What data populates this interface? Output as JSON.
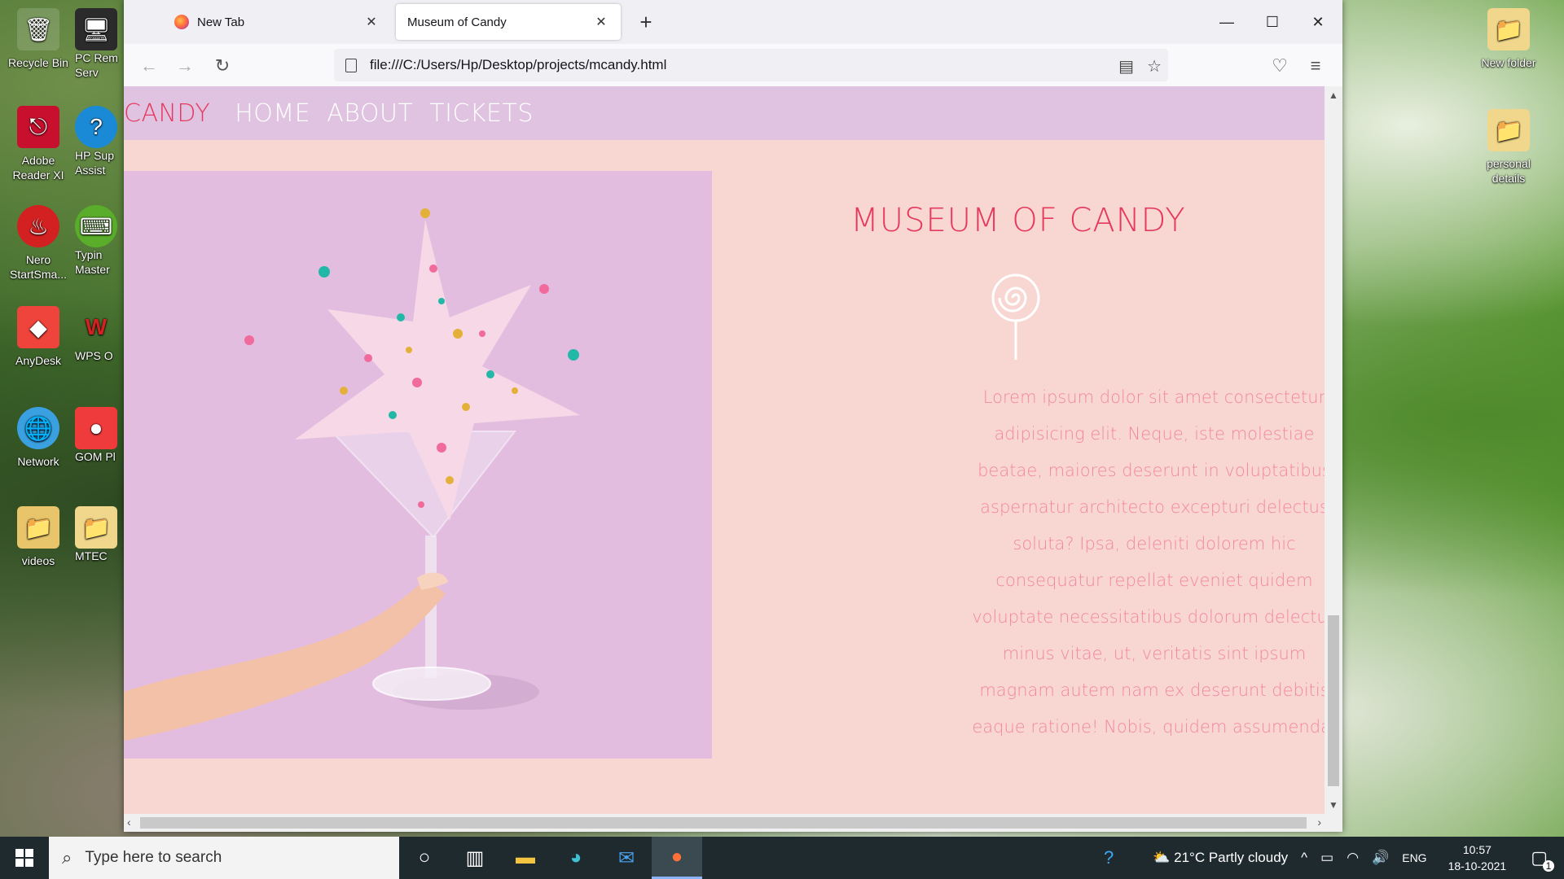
{
  "desktop": {
    "icons_left": [
      {
        "label": "Recycle Bin",
        "icon": "recycle-bin-icon"
      },
      {
        "label": "PC Rem Serv",
        "icon": "remote-icon"
      },
      {
        "label": "Adobe Reader XI",
        "icon": "pdf-icon"
      },
      {
        "label": "HP Sup Assist",
        "icon": "help-icon"
      },
      {
        "label": "Nero StartSma...",
        "icon": "nero-icon"
      },
      {
        "label": "Typin Master",
        "icon": "typing-icon"
      },
      {
        "label": "AnyDesk",
        "icon": "anydesk-icon"
      },
      {
        "label": "WPS O",
        "icon": "wps-icon"
      },
      {
        "label": "Network",
        "icon": "network-icon"
      },
      {
        "label": "GOM Pl",
        "icon": "gom-icon"
      },
      {
        "label": "videos",
        "icon": "folder-icon"
      },
      {
        "label": "MTEC",
        "icon": "folder-icon"
      }
    ],
    "icons_right": [
      {
        "label": "New folder",
        "icon": "folder-icon"
      },
      {
        "label": "personal details",
        "icon": "folder-icon"
      }
    ]
  },
  "browser": {
    "tabs": [
      {
        "title": "New Tab"
      },
      {
        "title": "Museum of Candy"
      }
    ],
    "url": "file:///C:/Users/Hp/Desktop/projects/mcandy.html"
  },
  "site": {
    "brand": "CANDY",
    "nav": [
      "HOME",
      "ABOUT",
      "TICKETS"
    ],
    "title": "MUSEUM OF CANDY",
    "body": "Lorem ipsum dolor sit amet consectetur adipisicing elit. Neque, iste molestiae beatae, maiores deserunt in voluptatibus aspernatur architecto excepturi delectus soluta? Ipsa, deleniti dolorem hic consequatur repellat eveniet quidem voluptate necessitatibus dolorum delectus minus vitae, ut, veritatis sint ipsum magnam autem nam ex deserunt debitis eaque ratione! Nobis, quidem assumenda."
  },
  "taskbar": {
    "search_placeholder": "Type here to search",
    "weather": "21°C  Partly cloudy",
    "lang": "ENG",
    "time": "10:57",
    "date": "18-10-2021",
    "notification_count": "1"
  },
  "colors": {
    "accent": "#e6395e",
    "nav_bg": "#dfc3e0",
    "page_bg": "#f8d7d3",
    "text_pink": "#f2879f"
  }
}
